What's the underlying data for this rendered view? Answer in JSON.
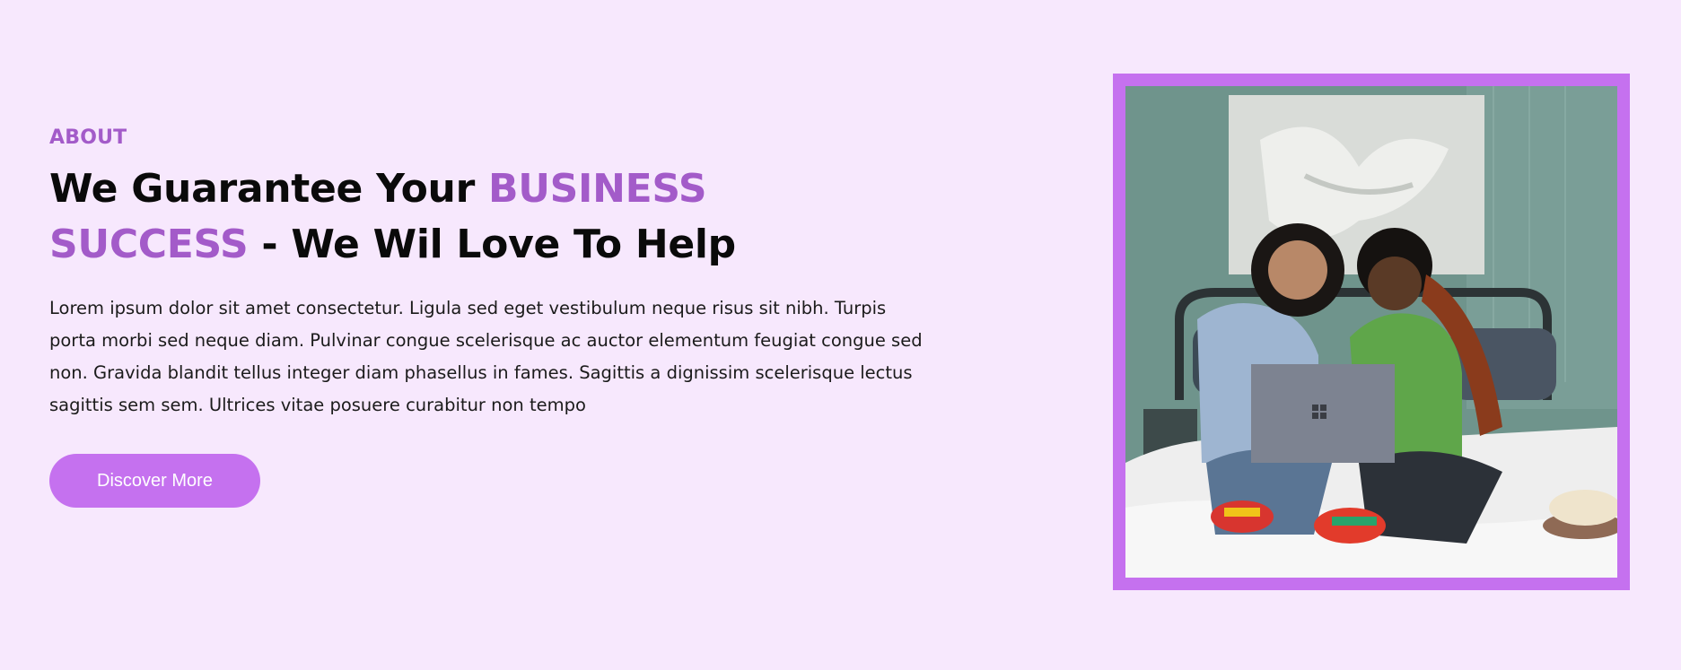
{
  "about": {
    "eyebrow": "ABOUT",
    "heading": {
      "part1": "We Guarantee Your ",
      "accent1": "BUSINESS",
      "accent2": "SUCCESS",
      "part2": " - We Wil Love To Help"
    },
    "body": "Lorem ipsum dolor sit amet consectetur. Ligula sed eget vestibulum neque risus sit nibh. Turpis porta morbi sed neque diam. Pulvinar congue scelerisque ac auctor elementum feugiat congue sed non. Gravida blandit tellus integer diam phasellus in fames. Sagittis a dignissim scelerisque lectus sagittis sem sem. Ultrices vitae posuere curabitur non tempo",
    "cta_label": "Discover More"
  },
  "colors": {
    "background": "#f7e8fd",
    "accent": "#a35bc9",
    "button": "#c571ef",
    "frame": "#c571ef"
  }
}
